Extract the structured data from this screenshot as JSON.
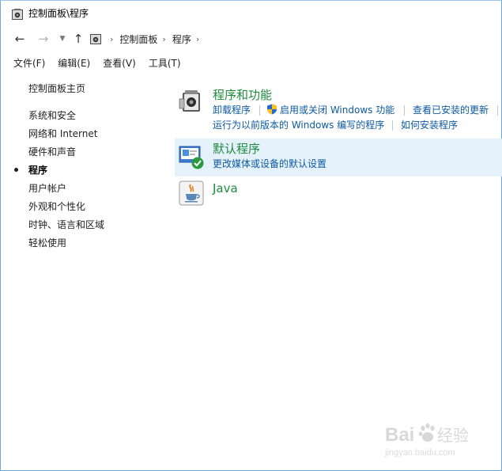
{
  "window": {
    "title": "控制面板\\程序"
  },
  "address": {
    "crumbs": [
      "控制面板",
      "程序"
    ]
  },
  "menu": {
    "items": [
      "文件(F)",
      "编辑(E)",
      "查看(V)",
      "工具(T)"
    ]
  },
  "sidebar": {
    "home": "控制面板主页",
    "items": [
      "系统和安全",
      "网络和 Internet",
      "硬件和声音",
      "程序",
      "用户帐户",
      "外观和个性化",
      "时钟、语言和区域",
      "轻松使用"
    ],
    "current_index": 3
  },
  "sections": {
    "programs": {
      "title": "程序和功能",
      "links": [
        "卸载程序",
        "启用或关闭 Windows 功能",
        "查看已安装的更新",
        "运行为以前版本的 Windows 编写的程序",
        "如何安装程序"
      ]
    },
    "defaults": {
      "title": "默认程序",
      "links": [
        "更改媒体或设备的默认设置"
      ]
    },
    "java": {
      "title": "Java"
    }
  },
  "watermark": {
    "brand": "Bai",
    "brand2": "经验",
    "url": "jingyan.baidu.com"
  },
  "colors": {
    "title_green": "#1e8a3c",
    "link_blue": "#0c5aa0",
    "highlight": "#e5f1fb"
  },
  "icons": {
    "title": "control-panel-icon",
    "back": "arrow-left-icon",
    "forward": "arrow-right-icon",
    "recent": "chevron-down-icon",
    "up": "arrow-up-icon",
    "shield": "uac-shield-icon"
  }
}
